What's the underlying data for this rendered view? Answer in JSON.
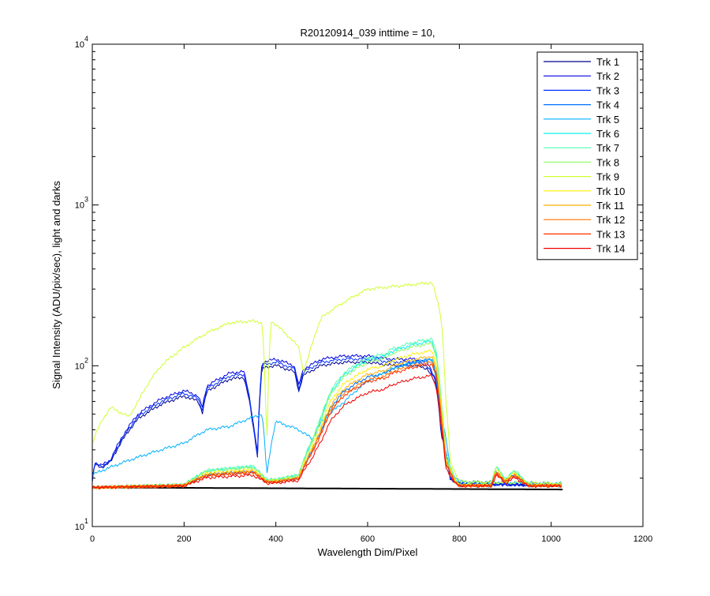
{
  "chart_data": {
    "type": "line",
    "title": "R20120914_039 inttime = 10,",
    "xlabel": "Wavelength Dim/Pixel",
    "ylabel": "Signal Intensity (ADU/pix/sec), light and darks",
    "xlim": [
      0,
      1200
    ],
    "ylim": [
      10,
      10000
    ],
    "yscale": "log",
    "xticks": [
      "0",
      "200",
      "400",
      "600",
      "800",
      "1000",
      "1200"
    ],
    "yticks": [
      {
        "base": "10",
        "exp": "1"
      },
      {
        "base": "10",
        "exp": "2"
      },
      {
        "base": "10",
        "exp": "3"
      },
      {
        "base": "10",
        "exp": "4"
      }
    ],
    "grid": false,
    "legend_position": "top-right",
    "series": [
      {
        "name": "Trk 1",
        "color": "#00008F",
        "group": "A",
        "factor": 0.9
      },
      {
        "name": "Trk 2",
        "color": "#0000DF",
        "group": "A",
        "factor": 1.0
      },
      {
        "name": "Trk 3",
        "color": "#0030FF",
        "group": "A",
        "factor": 0.95
      },
      {
        "name": "Trk 4",
        "color": "#0070FF",
        "group": "B",
        "factor": 1.0
      },
      {
        "name": "Trk 5",
        "color": "#00B0FF",
        "group": "C",
        "factor": 1.0
      },
      {
        "name": "Trk 6",
        "color": "#10F0EF",
        "group": "B",
        "factor": 1.35
      },
      {
        "name": "Trk 7",
        "color": "#50FFAF",
        "group": "B",
        "factor": 1.4
      },
      {
        "name": "Trk 8",
        "color": "#90FF6F",
        "group": "B",
        "factor": 1.3
      },
      {
        "name": "Trk 9",
        "color": "#CFFF30",
        "group": "D",
        "factor": 1.0
      },
      {
        "name": "Trk 10",
        "color": "#FFEF00",
        "group": "B",
        "factor": 1.15
      },
      {
        "name": "Trk 11",
        "color": "#FFB000",
        "group": "B",
        "factor": 1.05
      },
      {
        "name": "Trk 12",
        "color": "#FF7000",
        "group": "B",
        "factor": 0.95
      },
      {
        "name": "Trk 13",
        "color": "#FF3000",
        "group": "B",
        "factor": 0.92
      },
      {
        "name": "Trk 14",
        "color": "#EF0000",
        "group": "B",
        "factor": 0.75
      }
    ],
    "profiles": {
      "A": [
        [
          0,
          19
        ],
        [
          5,
          25
        ],
        [
          20,
          24
        ],
        [
          40,
          26
        ],
        [
          60,
          34
        ],
        [
          100,
          50
        ],
        [
          150,
          62
        ],
        [
          200,
          70
        ],
        [
          230,
          65
        ],
        [
          240,
          55
        ],
        [
          250,
          75
        ],
        [
          300,
          90
        ],
        [
          330,
          92
        ],
        [
          340,
          70
        ],
        [
          350,
          45
        ],
        [
          360,
          28
        ],
        [
          370,
          105
        ],
        [
          400,
          110
        ],
        [
          440,
          100
        ],
        [
          450,
          75
        ],
        [
          460,
          95
        ],
        [
          500,
          110
        ],
        [
          550,
          115
        ],
        [
          600,
          115
        ],
        [
          650,
          110
        ],
        [
          700,
          110
        ],
        [
          730,
          105
        ],
        [
          750,
          80
        ],
        [
          760,
          40
        ],
        [
          780,
          20
        ],
        [
          800,
          18.5
        ],
        [
          1025,
          18
        ]
      ],
      "B": [
        [
          0,
          17.5
        ],
        [
          200,
          18
        ],
        [
          250,
          21
        ],
        [
          350,
          22
        ],
        [
          380,
          19
        ],
        [
          400,
          19
        ],
        [
          450,
          20
        ],
        [
          480,
          30
        ],
        [
          500,
          40
        ],
        [
          520,
          55
        ],
        [
          550,
          70
        ],
        [
          600,
          85
        ],
        [
          640,
          90
        ],
        [
          650,
          95
        ],
        [
          700,
          105
        ],
        [
          740,
          110
        ],
        [
          750,
          90
        ],
        [
          760,
          50
        ],
        [
          770,
          25
        ],
        [
          790,
          19
        ],
        [
          800,
          18
        ],
        [
          870,
          18
        ],
        [
          880,
          22
        ],
        [
          900,
          19
        ],
        [
          920,
          21
        ],
        [
          950,
          18
        ],
        [
          1025,
          18
        ]
      ],
      "C": [
        [
          0,
          21
        ],
        [
          50,
          24
        ],
        [
          100,
          27
        ],
        [
          200,
          33
        ],
        [
          250,
          40
        ],
        [
          300,
          42
        ],
        [
          350,
          48
        ],
        [
          370,
          50
        ],
        [
          380,
          20
        ],
        [
          400,
          45
        ],
        [
          450,
          40
        ],
        [
          480,
          35
        ],
        [
          500,
          45
        ],
        [
          550,
          60
        ],
        [
          600,
          80
        ],
        [
          650,
          95
        ],
        [
          700,
          105
        ],
        [
          740,
          110
        ],
        [
          760,
          50
        ],
        [
          780,
          22
        ],
        [
          800,
          19
        ],
        [
          1025,
          18.5
        ]
      ],
      "D": [
        [
          0,
          33
        ],
        [
          20,
          45
        ],
        [
          40,
          55
        ],
        [
          80,
          48
        ],
        [
          100,
          60
        ],
        [
          150,
          100
        ],
        [
          200,
          130
        ],
        [
          250,
          160
        ],
        [
          300,
          185
        ],
        [
          350,
          190
        ],
        [
          370,
          185
        ],
        [
          380,
          20
        ],
        [
          390,
          190
        ],
        [
          420,
          160
        ],
        [
          450,
          130
        ],
        [
          460,
          90
        ],
        [
          470,
          110
        ],
        [
          500,
          200
        ],
        [
          550,
          250
        ],
        [
          600,
          300
        ],
        [
          650,
          310
        ],
        [
          700,
          320
        ],
        [
          740,
          330
        ],
        [
          760,
          200
        ],
        [
          770,
          60
        ],
        [
          780,
          25
        ],
        [
          800,
          19
        ],
        [
          1025,
          18.5
        ]
      ],
      "dark": [
        [
          0,
          17.5
        ],
        [
          1025,
          17
        ]
      ]
    }
  }
}
